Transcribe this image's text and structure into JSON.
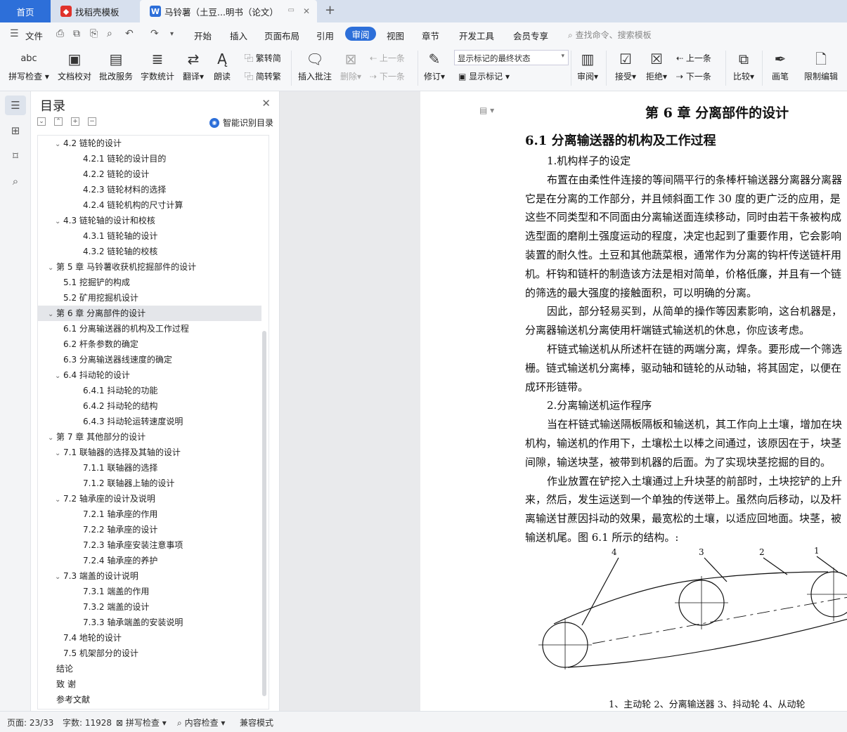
{
  "tabs": {
    "home": "首页",
    "template": "找稻壳模板",
    "doc": "马铃薯（土豆...明书（论文）",
    "add_icon": "plus-icon"
  },
  "menu": {
    "file": "文件",
    "items": [
      "开始",
      "插入",
      "页面布局",
      "引用",
      "审阅",
      "视图",
      "章节",
      "开发工具",
      "会员专享"
    ],
    "active": "审阅",
    "search_placeholder": "查找命令、搜索模板"
  },
  "ribbon": {
    "spell_check": "拼写检查",
    "spell_icon_text": "abc",
    "doc_proof": "文档校对",
    "batch_service": "批改服务",
    "word_count": "字数统计",
    "translate": "翻译",
    "read_aloud": "朗读",
    "to_traditional": "繁转简",
    "to_simplified": "简转繁",
    "insert_comment": "插入批注",
    "delete": "删除",
    "prev_comment": "上一条",
    "next_comment": "下一条",
    "revise": "修订",
    "markup_state": "显示标记的最终状态",
    "show_markup": "显示标记",
    "review": "审阅",
    "accept": "接受",
    "reject": "拒绝",
    "prev_change": "上一条",
    "next_change": "下一条",
    "compare": "比较",
    "ink": "画笔",
    "restrict_edit": "限制编辑"
  },
  "toc": {
    "title": "目录",
    "smart": "智能识别目录",
    "items": [
      {
        "text": "4.2  链轮的设计",
        "level": 2,
        "caret": true
      },
      {
        "text": "4.2.1  链轮的设计目的",
        "level": 3
      },
      {
        "text": "4.2.2  链轮的设计",
        "level": 3
      },
      {
        "text": "4.2.3  链轮材料的选择",
        "level": 3
      },
      {
        "text": "4.2.4  链轮机构的尺寸计算",
        "level": 3
      },
      {
        "text": "4.3 链轮轴的设计和校核",
        "level": 2,
        "caret": true
      },
      {
        "text": "4.3.1  链轮轴的设计",
        "level": 3
      },
      {
        "text": "4.3.2  链轮轴的校核",
        "level": 3
      },
      {
        "text": "第 5 章  马铃薯收获机挖掘部件的设计",
        "level": 1,
        "caret": true
      },
      {
        "text": "5.1  挖掘铲的构成",
        "level": 2
      },
      {
        "text": "5.2  矿用挖掘机设计",
        "level": 2
      },
      {
        "text": "第 6 章  分离部件的设计",
        "level": 1,
        "caret": true,
        "selected": true
      },
      {
        "text": "6.1  分离输送器的机构及工作过程",
        "level": 2
      },
      {
        "text": "6.2  杆条参数的确定",
        "level": 2
      },
      {
        "text": "6.3  分离输送器线速度的确定",
        "level": 2
      },
      {
        "text": "6.4  抖动轮的设计",
        "level": 2,
        "caret": true
      },
      {
        "text": "6.4.1  抖动轮的功能",
        "level": 3
      },
      {
        "text": "6.4.2  抖动轮的结构",
        "level": 3
      },
      {
        "text": "6.4.3  抖动轮运转速度说明",
        "level": 3
      },
      {
        "text": "第 7 章  其他部分的设计",
        "level": 1,
        "caret": true
      },
      {
        "text": "7.1 联轴器的选择及其轴的设计",
        "level": 2,
        "caret": true
      },
      {
        "text": "7.1.1  联轴器的选择",
        "level": 3
      },
      {
        "text": "7.1.2  联轴器上轴的设计",
        "level": 3
      },
      {
        "text": "7.2  轴承座的设计及说明",
        "level": 2,
        "caret": true
      },
      {
        "text": "7.2.1 轴承座的作用",
        "level": 3
      },
      {
        "text": "7.2.2  轴承座的设计",
        "level": 3
      },
      {
        "text": "7.2.3  轴承座安装注意事项",
        "level": 3
      },
      {
        "text": "7.2.4  轴承座的养护",
        "level": 3
      },
      {
        "text": "7.3  端盖的设计说明",
        "level": 2,
        "caret": true
      },
      {
        "text": "7.3.1  端盖的作用",
        "level": 3
      },
      {
        "text": "7.3.2  端盖的设计",
        "level": 3
      },
      {
        "text": "7.3.3  轴承端盖的安装说明",
        "level": 3
      },
      {
        "text": "7.4  地轮的设计",
        "level": 2
      },
      {
        "text": "7.5  机架部分的设计",
        "level": 2
      },
      {
        "text": "结论",
        "level": 1
      },
      {
        "text": "致    谢",
        "level": 1
      },
      {
        "text": "参考文献",
        "level": 1
      }
    ]
  },
  "document": {
    "chapter_title": "第 6 章  分离部件的设计",
    "section_title": "6.1  分离输送器的机构及工作过程",
    "lines": [
      {
        "text": "1.机构样子的设定",
        "indent": true
      },
      {
        "text": "布置在由柔性件连接的等间隔平行的条棒杆输送器分离器分离器",
        "indent": true
      },
      {
        "text": "它是在分离的工作部分，并且倾斜面工作 30 度的更广泛的应用，是",
        "indent": false
      },
      {
        "text": "这些不同类型和不同面由分离输送面连续移动，同时由若干条被构成",
        "indent": false
      },
      {
        "text": "选型面的磨削土强度运动的程度，决定也起到了重要作用，它会影响",
        "indent": false
      },
      {
        "text": "装置的耐久性。土豆和其他蔬菜根，通常作为分离的钩杆传送链杆用",
        "indent": false
      },
      {
        "text": "机。杆钩和链杆的制造该方法是相对简单，价格低廉，并且有一个链",
        "indent": false
      },
      {
        "text": "的筛选的最大强度的接触面积，可以明确的分离。",
        "indent": false
      },
      {
        "text": "因此，部分轻易买到，从简单的操作等因素影响，这台机器是，",
        "indent": true
      },
      {
        "text": "分离器输送机分离使用杆端链式输送机的休息，你应该考虑。",
        "indent": false
      },
      {
        "text": "杆链式输送机从所述杆在链的两端分离，焊条。要形成一个筛选",
        "indent": true
      },
      {
        "text": "栅。链式输送机分离棒，驱动轴和链轮的从动轴，将其固定，以便在",
        "indent": false
      },
      {
        "text": "成环形链带。",
        "indent": false
      },
      {
        "text": "2.分离输送机运作程序",
        "indent": true
      },
      {
        "text": "当在杆链式输送隔板隔板和输送机，其工作向上土壤，增加在块",
        "indent": true
      },
      {
        "text": "机构，输送机的作用下，土壤松土以棒之间通过，该原因在于，块茎",
        "indent": false
      },
      {
        "text": "间隙，输送块茎，被带到机器的后面。为了实现块茎挖掘的目的。",
        "indent": false
      },
      {
        "text": "作业放置在铲挖入土壤通过上升块茎的前部时，土块挖铲的上升",
        "indent": true
      },
      {
        "text": "来，然后，发生运送到一个单独的传送带上。虽然向后移动，以及杆",
        "indent": false
      },
      {
        "text": "离输送甘蔗因抖动的效果，最宽松的土壤，以适应回地面。块茎，被",
        "indent": false
      },
      {
        "text": "输送机尾。图 6.1 所示的结构。:",
        "indent": false
      }
    ],
    "figure_labels": [
      "4",
      "3",
      "2",
      "1"
    ],
    "caption": "1、主动轮   2、分离输送器   3、抖动轮   4、从动轮"
  },
  "status": {
    "page": "页面: 23/33",
    "words": "字数: 11928",
    "spell": "拼写检查",
    "content": "内容检查",
    "mode": "兼容模式"
  },
  "colors": {
    "accent": "#2d6fd9",
    "tabbar": "#d7e0ee",
    "ribbon": "#f6f7f9",
    "canvas": "#e9eaec"
  }
}
